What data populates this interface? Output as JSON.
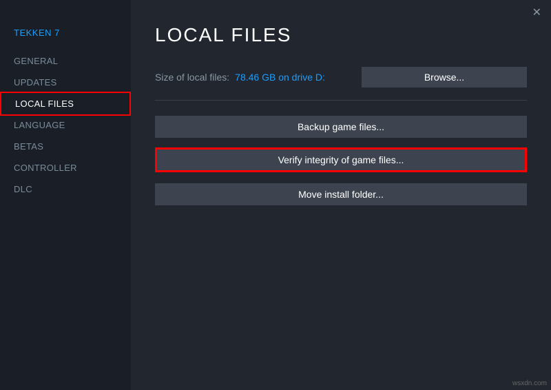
{
  "game_title": "TEKKEN 7",
  "nav": {
    "general": "GENERAL",
    "updates": "UPDATES",
    "local_files": "LOCAL FILES",
    "language": "LANGUAGE",
    "betas": "BETAS",
    "controller": "CONTROLLER",
    "dlc": "DLC"
  },
  "header": {
    "title": "LOCAL FILES"
  },
  "size": {
    "label": "Size of local files:",
    "value": "78.46 GB on drive D:"
  },
  "buttons": {
    "browse": "Browse...",
    "backup": "Backup game files...",
    "verify": "Verify integrity of game files...",
    "move": "Move install folder..."
  },
  "watermark": "wsxdn.com"
}
